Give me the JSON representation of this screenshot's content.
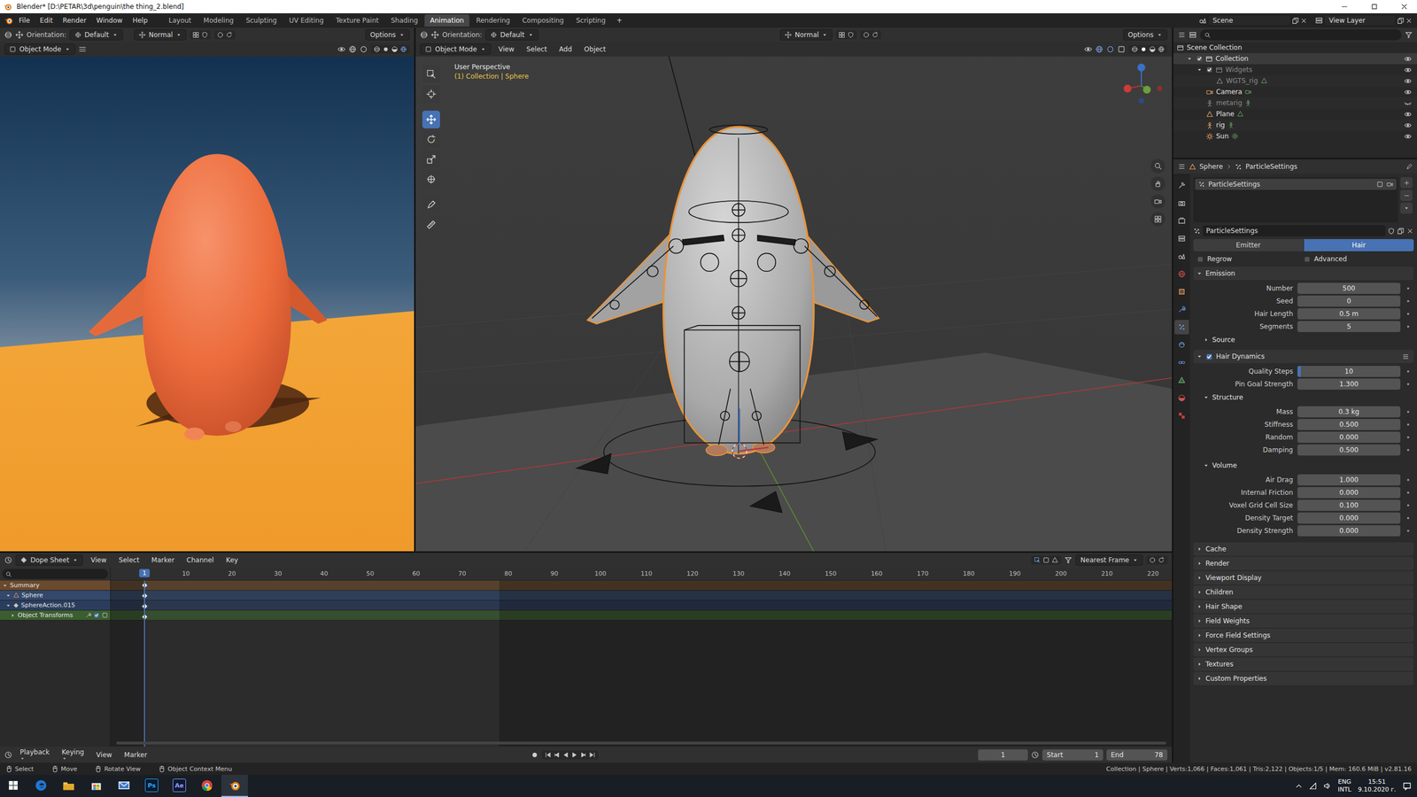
{
  "window": {
    "title": "Blender* [D:\\PETAR\\3d\\penguin\\the thing_2.blend]"
  },
  "menu": [
    "File",
    "Edit",
    "Render",
    "Window",
    "Help"
  ],
  "workspaces": [
    {
      "label": "Layout",
      "selected": false
    },
    {
      "label": "Modeling",
      "selected": false
    },
    {
      "label": "Sculpting",
      "selected": false
    },
    {
      "label": "UV Editing",
      "selected": false
    },
    {
      "label": "Texture Paint",
      "selected": false
    },
    {
      "label": "Shading",
      "selected": false
    },
    {
      "label": "Animation",
      "selected": true
    },
    {
      "label": "Rendering",
      "selected": false
    },
    {
      "label": "Compositing",
      "selected": false
    },
    {
      "label": "Scripting",
      "selected": false
    }
  ],
  "add_workspace": "+",
  "scene": "Scene",
  "view_layer": "View Layer",
  "render_view": {
    "orientation_label": "Orientation:",
    "orientation": "Default",
    "transform_orientation": "Normal",
    "options": "Options",
    "mode": "Object Mode"
  },
  "viewport": {
    "orientation_label": "Orientation:",
    "orientation": "Default",
    "transform_orientation": "Normal",
    "options": "Options",
    "mode": "Object Mode",
    "menus": [
      "View",
      "Select",
      "Add",
      "Object"
    ],
    "overlay_title": "User Perspective",
    "overlay_context": "(1) Collection | Sphere",
    "tools": [
      {
        "selected": false
      },
      {
        "selected": false
      },
      {
        "selected": true
      },
      {
        "selected": false
      },
      {
        "selected": false
      },
      {
        "selected": false
      },
      {
        "selected": false
      },
      {
        "selected": false
      }
    ]
  },
  "outliner": {
    "root": "Scene Collection",
    "items": [
      {
        "label": "Collection",
        "kind": "collection",
        "expanded": true,
        "selected": true,
        "dimmed": false,
        "visible": true,
        "children": [
          {
            "label": "Widgets",
            "kind": "collection",
            "expanded": true,
            "selected": false,
            "dimmed": true,
            "visible": true,
            "children": [
              {
                "label": "WGTS_rig",
                "kind": "mesh",
                "expanded": false,
                "selected": false,
                "dimmed": true,
                "visible": true,
                "children": []
              }
            ]
          },
          {
            "label": "Camera",
            "kind": "camera",
            "expanded": false,
            "selected": false,
            "dimmed": false,
            "visible": true,
            "children": []
          },
          {
            "label": "metarig",
            "kind": "armature",
            "expanded": false,
            "selected": false,
            "dimmed": true,
            "visible": false,
            "children": []
          },
          {
            "label": "Plane",
            "kind": "mesh",
            "expanded": false,
            "selected": false,
            "dimmed": false,
            "visible": true,
            "children": []
          },
          {
            "label": "rig",
            "kind": "armature",
            "expanded": false,
            "selected": false,
            "dimmed": false,
            "visible": true,
            "children": []
          },
          {
            "label": "Sun",
            "kind": "light",
            "expanded": false,
            "selected": false,
            "dimmed": false,
            "visible": true,
            "children": []
          }
        ]
      }
    ]
  },
  "properties": {
    "editor_tabs": [
      {
        "selected": false
      },
      {
        "selected": false
      },
      {
        "selected": false
      },
      {
        "selected": false
      },
      {
        "selected": false
      },
      {
        "selected": false
      },
      {
        "selected": false
      },
      {
        "selected": false
      },
      {
        "selected": true
      },
      {
        "selected": false
      },
      {
        "selected": false
      },
      {
        "selected": false
      },
      {
        "selected": false
      },
      {
        "selected": false
      }
    ],
    "breadcrumb": [
      "Sphere",
      "ParticleSettings"
    ],
    "particle_systems": [
      {
        "label": "ParticleSettings",
        "selected": true
      }
    ],
    "datablock": "ParticleSettings",
    "type_tabs": [
      {
        "label": "Emitter",
        "selected": false
      },
      {
        "label": "Hair",
        "selected": true
      }
    ],
    "toggles": [
      {
        "label": "Regrow",
        "checked": false
      },
      {
        "label": "Advanced",
        "checked": false
      }
    ],
    "emission": {
      "title": "Emission",
      "expanded": true,
      "fields": [
        {
          "label": "Number",
          "value": "500",
          "kind": "field",
          "level": 0
        },
        {
          "label": "Seed",
          "value": "0",
          "kind": "field",
          "level": 0
        },
        {
          "label": "Hair Length",
          "value": "0.5 m",
          "kind": "field",
          "level": 0
        },
        {
          "label": "Segments",
          "value": "5",
          "kind": "field",
          "level": 0
        }
      ],
      "subpanels": [
        {
          "title": "Source",
          "expanded": false,
          "fields": []
        }
      ]
    },
    "hair_dynamics": {
      "title": "Hair Dynamics",
      "checked": true,
      "expanded": true,
      "fields": [
        {
          "label": "Quality Steps",
          "value": "10",
          "kind": "slider",
          "level": 0.03
        },
        {
          "label": "Pin Goal Strength",
          "value": "1.300",
          "kind": "field",
          "level": 0
        }
      ],
      "subpanels": [
        {
          "title": "Structure",
          "expanded": true,
          "fields": [
            {
              "label": "Mass",
              "value": "0.3 kg",
              "kind": "field",
              "level": 0
            },
            {
              "label": "Stiffness",
              "value": "0.500",
              "kind": "field",
              "level": 0
            },
            {
              "label": "Random",
              "value": "0.000",
              "kind": "field",
              "level": 0
            },
            {
              "label": "Damping",
              "value": "0.500",
              "kind": "field",
              "level": 0
            }
          ]
        },
        {
          "title": "Volume",
          "expanded": true,
          "fields": [
            {
              "label": "Air Drag",
              "value": "1.000",
              "kind": "field",
              "level": 0
            },
            {
              "label": "Internal Friction",
              "value": "0.000",
              "kind": "field",
              "level": 0
            },
            {
              "label": "Voxel Grid Cell Size",
              "value": "0.100",
              "kind": "field",
              "level": 0
            },
            {
              "label": "Density Target",
              "value": "0.000",
              "kind": "field",
              "level": 0
            },
            {
              "label": "Density Strength",
              "value": "0.000",
              "kind": "field",
              "level": 0
            }
          ]
        }
      ]
    },
    "panels": [
      {
        "title": "Cache",
        "expanded": false
      },
      {
        "title": "Render",
        "expanded": false
      },
      {
        "title": "Viewport Display",
        "expanded": false
      },
      {
        "title": "Children",
        "expanded": false
      },
      {
        "title": "Hair Shape",
        "expanded": false
      },
      {
        "title": "Field Weights",
        "expanded": false
      },
      {
        "title": "Force Field Settings",
        "expanded": false
      },
      {
        "title": "Vertex Groups",
        "expanded": false
      },
      {
        "title": "Textures",
        "expanded": false
      },
      {
        "title": "Custom Properties",
        "expanded": false
      }
    ]
  },
  "dopesheet": {
    "editor": "Dope Sheet",
    "menus": [
      "View",
      "Select",
      "Marker",
      "Channel",
      "Key"
    ],
    "snap": "Nearest Frame",
    "current_frame": "1",
    "ruler": [
      "10",
      "20",
      "30",
      "40",
      "50",
      "60",
      "70",
      "80",
      "90",
      "100",
      "110",
      "120",
      "130",
      "140",
      "150",
      "160",
      "170",
      "180",
      "190",
      "200",
      "210",
      "220"
    ],
    "channels": [
      {
        "label": "Summary",
        "kind": "summary",
        "expanded": true,
        "color": "#6a4a2c",
        "keys": [
          1
        ]
      },
      {
        "label": "Sphere",
        "kind": "object",
        "expanded": true,
        "color": "#33486b",
        "keys": [
          1
        ]
      },
      {
        "label": "SphereAction.015",
        "kind": "action",
        "expanded": true,
        "color": "#2b3d5e",
        "keys": [
          1
        ]
      },
      {
        "label": "Object Transforms",
        "kind": "group",
        "expanded": false,
        "color": "#3b5e30",
        "keys": [
          1
        ]
      }
    ]
  },
  "playback": {
    "menus": [
      "Playback",
      "Keying",
      "View",
      "Marker"
    ],
    "frame": "1",
    "start_label": "Start",
    "start": "1",
    "end_label": "End",
    "end": "78"
  },
  "status_bar": {
    "hints": [
      "Select",
      "Move",
      "Rotate View",
      "Object Context Menu"
    ],
    "stats": "Collection | Sphere | Verts:1,066 | Faces:1,061 | Tris:2,122 | Objects:1/5 | Mem: 160.6 MiB | v2.81.16"
  },
  "taskbar": {
    "apps": [
      {
        "kind": "edge",
        "selected": false
      },
      {
        "kind": "explorer",
        "selected": false
      },
      {
        "kind": "store",
        "selected": false
      },
      {
        "kind": "mail",
        "selected": false
      },
      {
        "kind": "badge",
        "label": "Ps",
        "color": "#31a8ff",
        "selected": false
      },
      {
        "kind": "badge",
        "label": "Ae",
        "color": "#9999ff",
        "selected": false
      },
      {
        "kind": "chrome",
        "selected": false
      },
      {
        "kind": "blender",
        "selected": true
      }
    ],
    "language": [
      "ENG",
      "INTL"
    ],
    "time": "15:51",
    "date": "9.10.2020 г."
  }
}
